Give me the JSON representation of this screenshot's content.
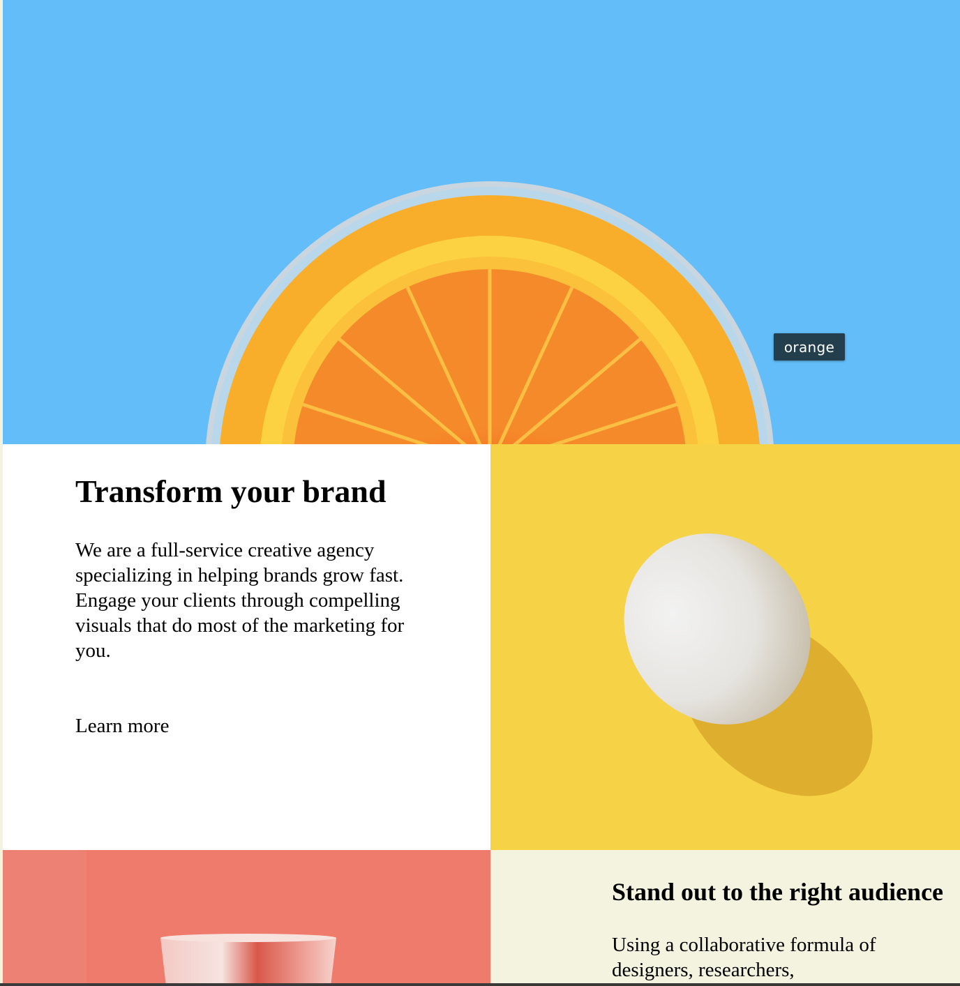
{
  "hero": {
    "image_name": "orange-juice-image",
    "background_color": "#63bdf9",
    "tooltip": "orange"
  },
  "section1": {
    "heading": "Transform your brand",
    "paragraph1": "We are a full-service creative agency specializing in helping brands grow fast.",
    "paragraph2": "Engage your clients through compelling visuals that do most of the marketing for you.",
    "link": "Learn more"
  },
  "egg_panel": {
    "image_name": "egg-image",
    "background_color": "#f6d246"
  },
  "cup_panel": {
    "image_name": "cup-image",
    "background_color": "#ee7b6c"
  },
  "section2": {
    "heading": "Stand out to the right audience",
    "paragraph": "Using a collaborative formula of designers, researchers,"
  }
}
